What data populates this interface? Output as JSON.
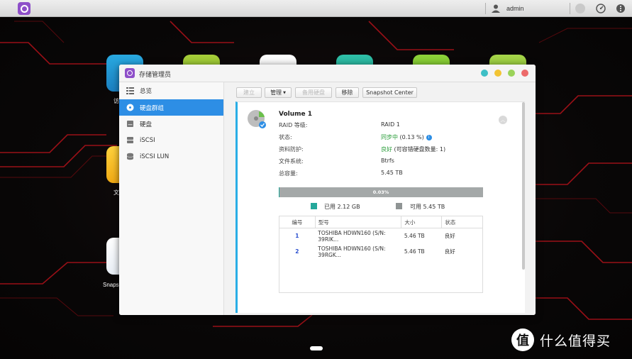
{
  "topbar": {
    "user_name": "admin"
  },
  "desktop": {
    "icon_labels": [
      "访",
      "文",
      "Snaps"
    ]
  },
  "window": {
    "title": "存储管理员",
    "sidebar": [
      {
        "label": "总览",
        "icon": "overview-icon"
      },
      {
        "label": "硬盘群组",
        "icon": "disk-group-icon",
        "active": true
      },
      {
        "label": "硬盘",
        "icon": "disk-icon"
      },
      {
        "label": "iSCSI",
        "icon": "iscsi-icon"
      },
      {
        "label": "iSCSI LUN",
        "icon": "iscsi-lun-icon"
      }
    ],
    "toolbar": {
      "create": "建立",
      "manage": "管理",
      "spare": "备用硬盘",
      "remove": "移除",
      "snapshot": "Snapshot Center"
    },
    "volume": {
      "name": "Volume 1",
      "props": [
        {
          "label": "RAID 等级:",
          "value": "RAID 1"
        },
        {
          "label": "状态:",
          "value": "同步中",
          "extra": " (0.13 %)"
        },
        {
          "label": "资料防护:",
          "value": "良好",
          "extra": " (可容错硬盘数量: 1)"
        },
        {
          "label": "文件系统:",
          "value": "Btrfs"
        },
        {
          "label": "总容量:",
          "value": "5.45 TB"
        }
      ],
      "usage_percent_label": "0.03%",
      "usage_fraction": 0.0003,
      "used_label": "已用 2.12 GB",
      "free_label": "可用 5.45 TB",
      "table": {
        "headers": [
          "编号",
          "型号",
          "大小",
          "状态"
        ],
        "rows": [
          {
            "num": "1",
            "model": "TOSHIBA HDWN160 (S/N: 39RIK...",
            "size": "5.46 TB",
            "status": "良好"
          },
          {
            "num": "2",
            "model": "TOSHIBA HDWN160 (S/N: 39RGK...",
            "size": "5.46 TB",
            "status": "良好"
          }
        ]
      }
    }
  },
  "watermark": {
    "logo": "值",
    "text": "什么值得买"
  },
  "colors": {
    "accent": "#2d8ee5",
    "used": "#25a89b",
    "free": "#8f9494",
    "ok_green": "#2a9d3a",
    "dot_teal": "#3ebfc6",
    "dot_yellow": "#f2c434",
    "dot_green": "#9bd35a",
    "dot_red": "#ec6a6a"
  }
}
